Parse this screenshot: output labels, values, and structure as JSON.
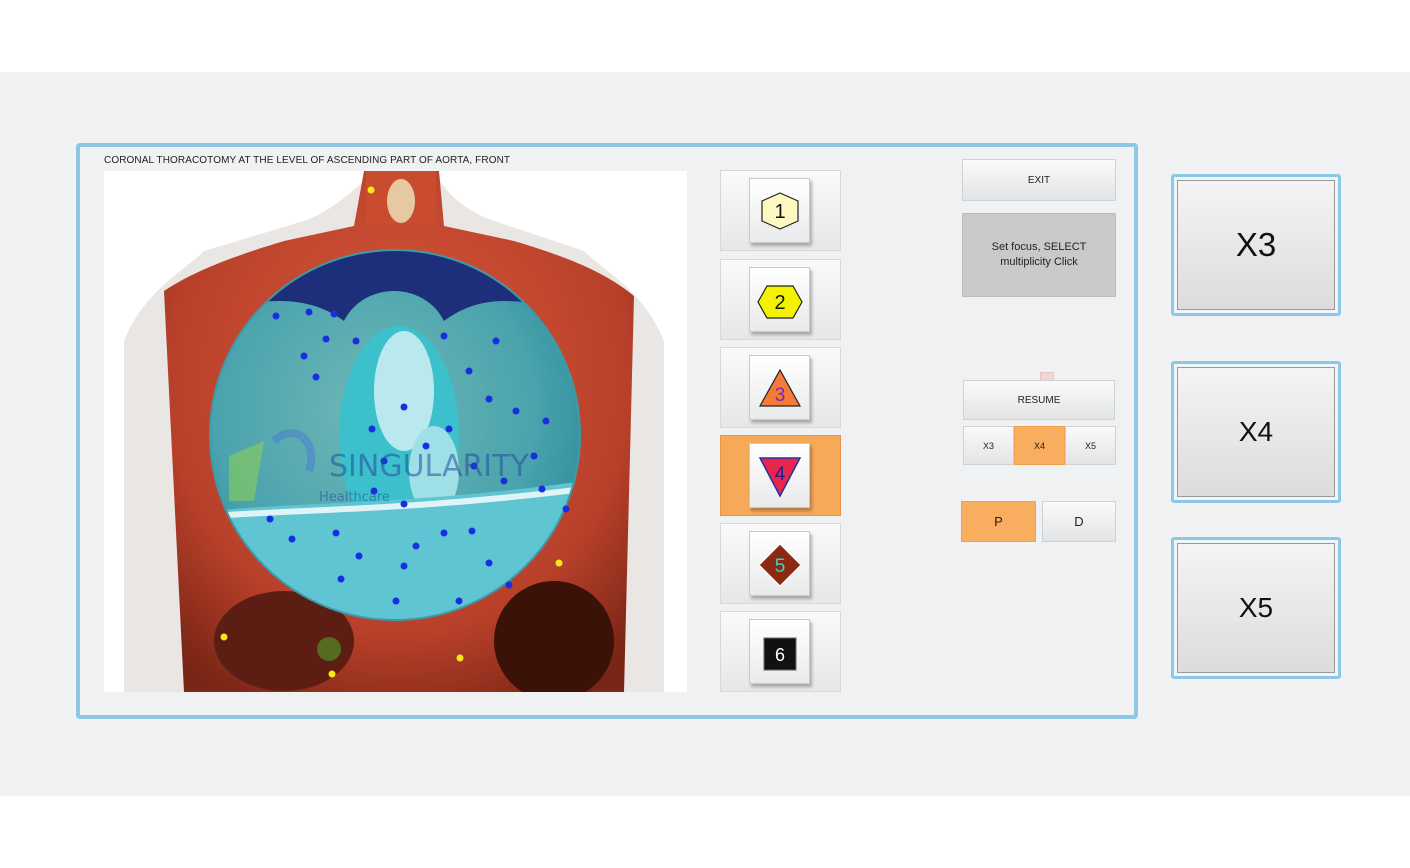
{
  "window": {
    "title": "CORONAL THORACOTOMY AT THE LEVEL OF ASCENDING PART OF AORTA, FRONT"
  },
  "image": {
    "watermark_text": "SINGULARITY",
    "watermark_sub": "Healthcare"
  },
  "markers": [
    {
      "label": "1",
      "shape": "hexagon",
      "fill": "#fdf8bf",
      "text_color": "#111111",
      "active": false
    },
    {
      "label": "2",
      "shape": "hexagon",
      "fill": "#f3f300",
      "text_color": "#111111",
      "active": false
    },
    {
      "label": "3",
      "shape": "triangle-up",
      "fill": "#f47a3a",
      "text_color": "#7a2aa8",
      "active": false
    },
    {
      "label": "4",
      "shape": "triangle-down",
      "fill": "#e8264c",
      "text_color": "#1b1b9a",
      "active": true
    },
    {
      "label": "5",
      "shape": "diamond",
      "fill": "#8b2a10",
      "text_color": "#3fd0c6",
      "active": false
    },
    {
      "label": "6",
      "shape": "square",
      "fill": "#111111",
      "text_color": "#ffffff",
      "active": false
    }
  ],
  "controls": {
    "exit_label": "EXIT",
    "info_text": "Set focus, SELECT multiplicity Click",
    "resume_label": "RESUME",
    "mult_small": [
      "X3",
      "X4",
      "X5"
    ],
    "mult_selected": "X4",
    "pd": [
      "P",
      "D"
    ],
    "pd_selected": "P"
  },
  "multiplicity_large": [
    "X3",
    "X4",
    "X5"
  ],
  "colors": {
    "accent_orange": "#f7a95a",
    "panel_border": "#8ec7e6",
    "background": "#f0f1f2"
  }
}
